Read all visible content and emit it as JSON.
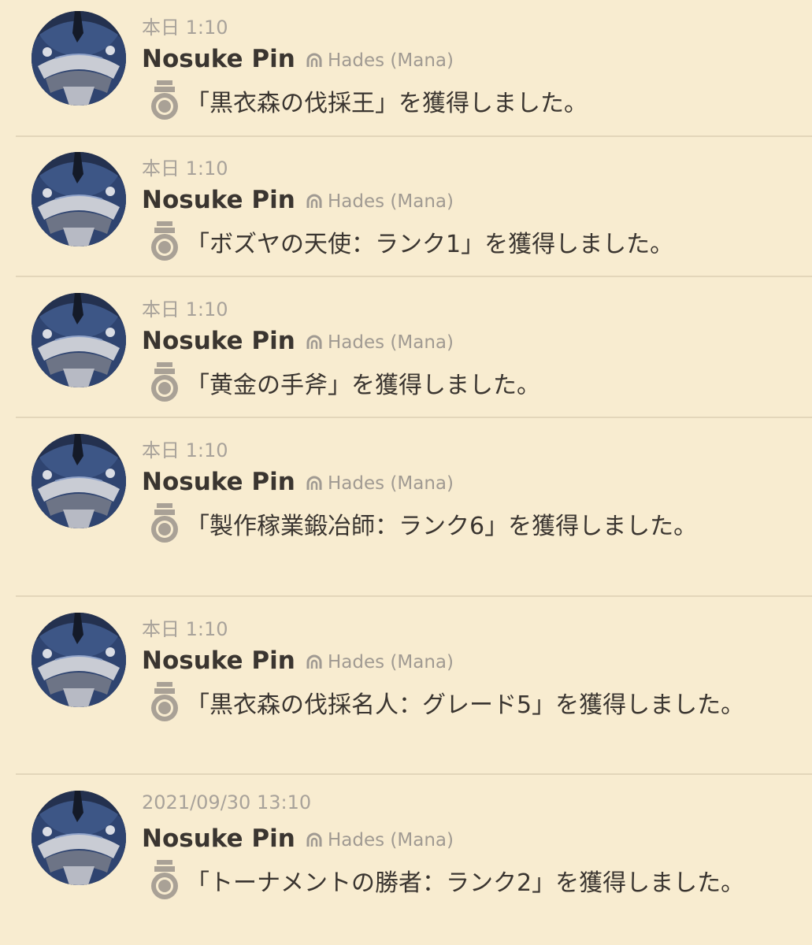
{
  "colors": {
    "background": "#f8ecd0",
    "divider": "#e3d6ba",
    "timestamp": "#a8a29a",
    "name": "#3a3530",
    "world": "#a09a92",
    "medal": "#a9a196"
  },
  "icons": {
    "medal": "medal-icon",
    "world": "world-server-icon"
  },
  "entries": [
    {
      "time": "本日 1:10",
      "name": "Nosuke Pin",
      "world": "Hades (Mana)",
      "message": "「黒衣森の伐採王」を獲得しました。"
    },
    {
      "time": "本日 1:10",
      "name": "Nosuke Pin",
      "world": "Hades (Mana)",
      "message": "「ボズヤの天使：ランク1」を獲得しました。"
    },
    {
      "time": "本日 1:10",
      "name": "Nosuke Pin",
      "world": "Hades (Mana)",
      "message": "「黄金の手斧」を獲得しました。"
    },
    {
      "time": "本日 1:10",
      "name": "Nosuke Pin",
      "world": "Hades (Mana)",
      "message": "「製作稼業鍛冶師：ランク6」を獲得しました。"
    },
    {
      "time": "本日 1:10",
      "name": "Nosuke Pin",
      "world": "Hades (Mana)",
      "message": "「黒衣森の伐採名人：グレード5」を獲得しました。"
    },
    {
      "time": "2021/09/30 13:10",
      "name": "Nosuke Pin",
      "world": "Hades (Mana)",
      "message": "「トーナメントの勝者：ランク2」を獲得しました。"
    }
  ]
}
